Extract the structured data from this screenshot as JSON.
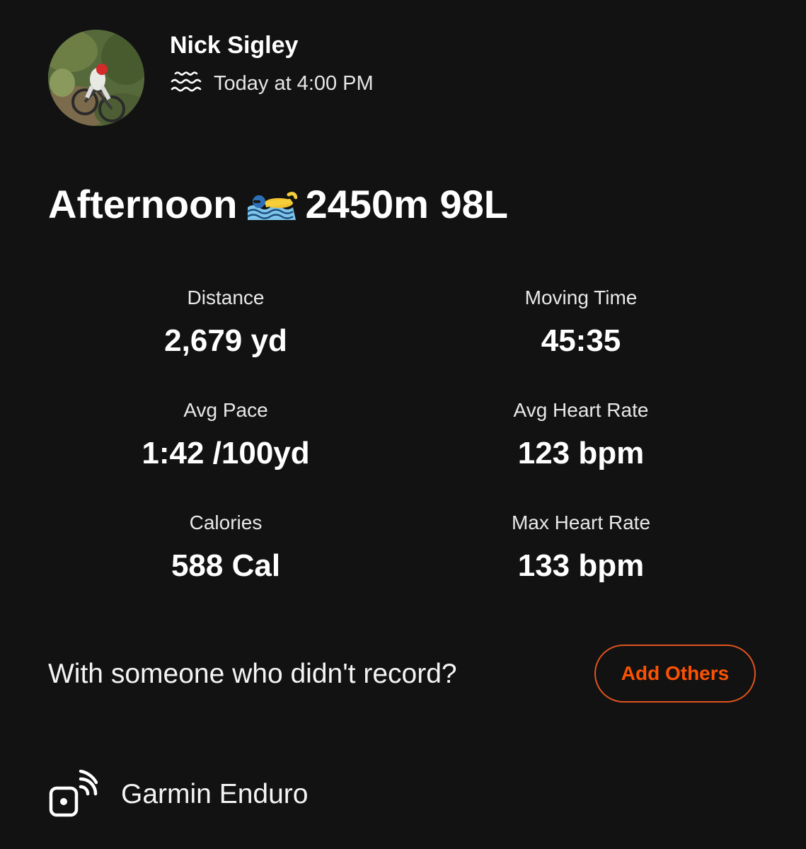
{
  "athlete": {
    "name": "Nick Sigley",
    "avatar_icon": "cyclist-photo"
  },
  "activity": {
    "sport_icon": "water-waves-icon",
    "timestamp": "Today at 4:00 PM",
    "title_start": "Afternoon",
    "title_emoji": "swimmer-emoji",
    "title_end": "2450m 98L"
  },
  "stats": {
    "distance": {
      "label": "Distance",
      "value": "2,679 yd"
    },
    "moving_time": {
      "label": "Moving Time",
      "value": "45:35"
    },
    "avg_pace": {
      "label": "Avg Pace",
      "value": "1:42 /100yd"
    },
    "avg_heart_rate": {
      "label": "Avg Heart Rate",
      "value": "123 bpm"
    },
    "calories": {
      "label": "Calories",
      "value": "588 Cal"
    },
    "max_heart_rate": {
      "label": "Max Heart Rate",
      "value": "133 bpm"
    }
  },
  "partners": {
    "prompt": "With someone who didn't record?",
    "button_label": "Add Others"
  },
  "device": {
    "icon": "connected-device-icon",
    "name": "Garmin Enduro"
  },
  "colors": {
    "background": "#121212",
    "text": "#ffffff",
    "accent": "#fc5200"
  }
}
